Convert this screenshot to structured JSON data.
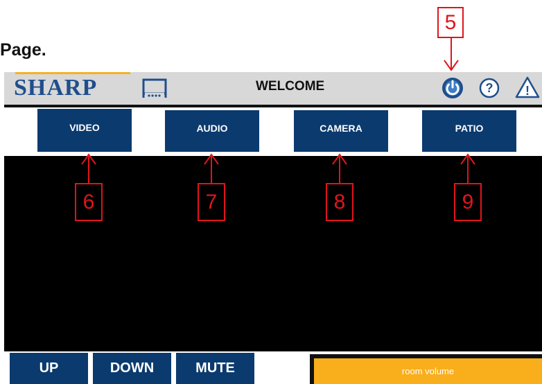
{
  "page": {
    "heading": "Page."
  },
  "header": {
    "logo": "SHARP",
    "title": "WELCOME",
    "icons": [
      "display-icon",
      "power-icon",
      "help-icon",
      "warning-icon"
    ],
    "help_glyph": "?",
    "warning_glyph": "!"
  },
  "nav": {
    "items": [
      {
        "label": "VIDEO"
      },
      {
        "label": "AUDIO"
      },
      {
        "label": "CAMERA"
      },
      {
        "label": "PATIO"
      }
    ]
  },
  "callouts": [
    {
      "number": "5",
      "target": "power-icon"
    },
    {
      "number": "6",
      "target": "VIDEO"
    },
    {
      "number": "7",
      "target": "AUDIO"
    },
    {
      "number": "8",
      "target": "CAMERA"
    },
    {
      "number": "9",
      "target": "PATIO"
    }
  ],
  "controls": {
    "up_label": "UP",
    "down_label": "DOWN",
    "mute_label": "MUTE",
    "volume_label": "room volume"
  },
  "colors": {
    "brand_blue": "#1f4e8c",
    "button_blue": "#0b3a6e",
    "accent_orange": "#f9ae1c",
    "callout_red": "#e0151b",
    "header_gray": "#d8d8d8"
  }
}
